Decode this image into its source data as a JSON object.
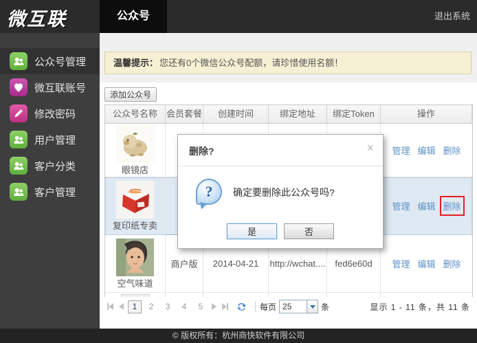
{
  "topbar": {
    "logo": "微互联",
    "tab": "公众号",
    "logout": "退出系统"
  },
  "sidebar": {
    "items": [
      {
        "label": "公众号管理",
        "icon": "users-icon",
        "active": true
      },
      {
        "label": "微互联账号",
        "icon": "heart-icon",
        "active": false
      },
      {
        "label": "修改密码",
        "icon": "pencil-icon",
        "active": false
      },
      {
        "label": "用户管理",
        "icon": "users-icon",
        "active": false
      },
      {
        "label": "客户分类",
        "icon": "users-icon",
        "active": false
      },
      {
        "label": "客户管理",
        "icon": "users-icon",
        "active": false
      }
    ]
  },
  "notice": {
    "bold": "温馨提示：",
    "text": "您还有0个微信公众号配额，请珍惜使用名额！"
  },
  "toolbar": {
    "add_button": "添加公众号"
  },
  "table": {
    "headers": [
      "公众号名称",
      "会员套餐",
      "创建时间",
      "绑定地址",
      "绑定Token",
      "操作"
    ],
    "actions": {
      "manage": "管理",
      "edit": "编辑",
      "delete": "删除"
    },
    "rows": [
      {
        "name": "眼镜店",
        "image": "pig-figurine",
        "plan": "",
        "created": "",
        "url": "",
        "token": "",
        "selected": false
      },
      {
        "name": "复印纸专卖",
        "image": "red-box-product",
        "plan": "",
        "created": "",
        "url": "",
        "token": "",
        "selected": true,
        "delete_highlighted": true
      },
      {
        "name": "空气味道",
        "image": "portrait-photo",
        "plan": "商户版",
        "created": "2014-04-21",
        "url": "http://wchat....",
        "token": "fed6e60d",
        "selected": false
      }
    ]
  },
  "pagination": {
    "pages": [
      "1",
      "2",
      "3",
      "4",
      "5"
    ],
    "current": "1",
    "per_page_label": "每页",
    "per_page_value": "25",
    "unit": "条",
    "summary": "显示 1 - 11 条，共 11 条"
  },
  "dialog": {
    "title": "删除?",
    "close": "×",
    "message": "确定要删除此公众号吗?",
    "yes": "是",
    "no": "否"
  },
  "footer": {
    "copyright": "© 版权所有：杭州商快软件有限公司"
  },
  "colors": {
    "accent_link_blue": "#5e93c8",
    "annotation_red": "#e61e25",
    "sidebar_green": "#6fbd49",
    "sidebar_magenta": "#bb3a9e",
    "notice_bg": "#f6f0d4",
    "topbar_bg": "#2b2b2b",
    "sidebar_bg": "#3e3e3e",
    "selected_row_bg": "#dfe9f3"
  }
}
